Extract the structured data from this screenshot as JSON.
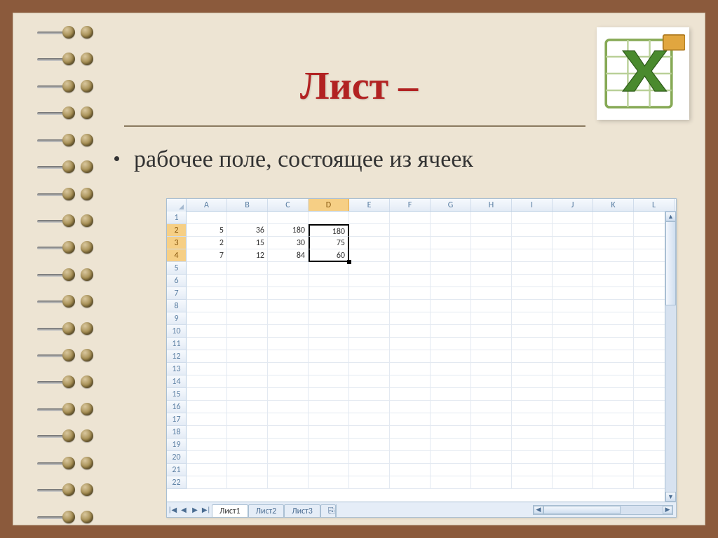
{
  "title": "Лист –",
  "bullet_text": "рабочее поле, состоящее из ячеек",
  "spreadsheet": {
    "columns": [
      "A",
      "B",
      "C",
      "D",
      "E",
      "F",
      "G",
      "H",
      "I",
      "J",
      "K",
      "L"
    ],
    "active_col": 3,
    "row_count": 22,
    "active_row_start": 2,
    "active_row_end": 4,
    "cells": {
      "2": {
        "A": "5",
        "B": "36",
        "C": "180",
        "D": "180"
      },
      "3": {
        "A": "2",
        "B": "15",
        "C": "30",
        "D": "75"
      },
      "4": {
        "A": "7",
        "B": "12",
        "C": "84",
        "D": "60"
      }
    },
    "tabs": [
      "Лист1",
      "Лист2",
      "Лист3"
    ],
    "active_tab": 0,
    "insert_tab_label": "⎘"
  },
  "nav": {
    "first": "|◀",
    "prev": "◀",
    "next": "▶",
    "last": "▶|"
  }
}
